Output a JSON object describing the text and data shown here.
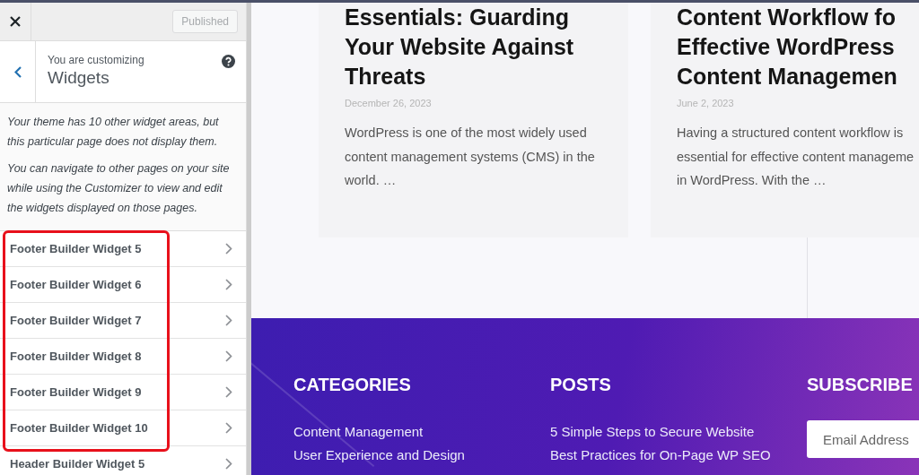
{
  "customizer": {
    "publish_button": {
      "label": "Published",
      "disabled": true
    },
    "header": {
      "eyebrow": "You are customizing",
      "title": "Widgets"
    },
    "notices": [
      "Your theme has 10 other widget areas, but this particular page does not display them.",
      "You can navigate to other pages on your site while using the Customizer to view and edit the widgets displayed on those pages."
    ],
    "widget_areas": [
      {
        "label": "Footer Builder Widget 5",
        "highlighted": true
      },
      {
        "label": "Footer Builder Widget 6",
        "highlighted": true
      },
      {
        "label": "Footer Builder Widget 7",
        "highlighted": true
      },
      {
        "label": "Footer Builder Widget 8",
        "highlighted": true
      },
      {
        "label": "Footer Builder Widget 9",
        "highlighted": true
      },
      {
        "label": "Footer Builder Widget 10",
        "highlighted": true
      },
      {
        "label": "Header Builder Widget 5",
        "highlighted": false
      }
    ]
  },
  "preview": {
    "posts": [
      {
        "title_lines": [
          "Essentials: Guarding",
          "Your Website Against",
          "Threats"
        ],
        "date": "December 26, 2023",
        "excerpt_lines": [
          "WordPress is one of the most widely used",
          "content management systems (CMS) in the",
          "world. …"
        ]
      },
      {
        "title_lines": [
          "Content Workflow fo",
          "Effective WordPress",
          "Content Managemen"
        ],
        "date": "June 2, 2023",
        "excerpt_lines": [
          "Having a structured content workflow is",
          "essential for effective content manageme",
          "in WordPress. With the …"
        ]
      }
    ],
    "footer": {
      "columns": [
        {
          "heading": "CATEGORIES",
          "links": [
            "Content Management",
            "User Experience and Design"
          ]
        },
        {
          "heading": "POSTS",
          "links": [
            "5 Simple Steps to Secure Website",
            "Best Practices for On-Page WP SEO"
          ]
        }
      ],
      "subscribe": {
        "heading": "SUBSCRIBE",
        "placeholder": "Email Address"
      }
    }
  }
}
